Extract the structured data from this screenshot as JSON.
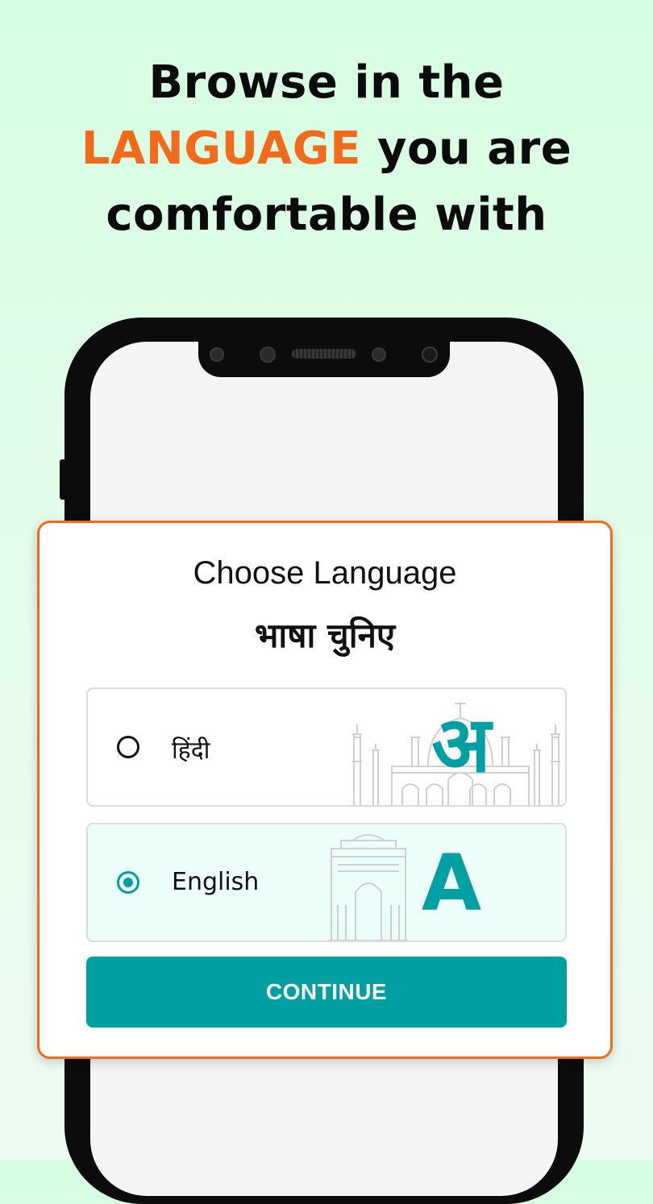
{
  "headline": {
    "line1": "Browse in the",
    "accent": "LANGUAGE",
    "line2_rest": " you are",
    "line3": "comfortable with"
  },
  "dialog": {
    "title": "Choose Language",
    "subtitle": "भाषा चुनिए",
    "options": [
      {
        "label": "हिंदी",
        "glyph": "अ",
        "selected": false,
        "decoration": "taj-mahal-outline"
      },
      {
        "label": "English",
        "glyph": "A",
        "selected": true,
        "decoration": "india-gate-outline"
      }
    ],
    "continue_label": "CONTINUE"
  },
  "colors": {
    "accent_orange": "#f26b1d",
    "teal": "#00a0a2",
    "background_green": "#d6fde1"
  }
}
